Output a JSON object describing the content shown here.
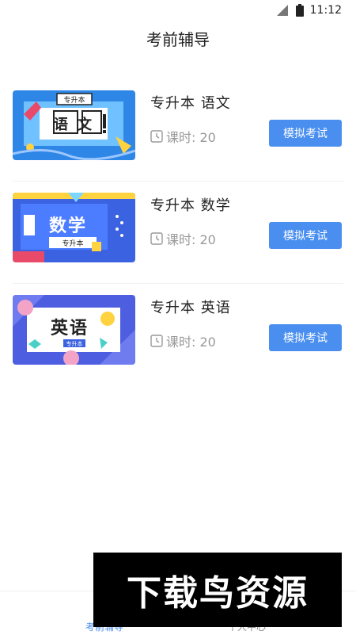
{
  "status_bar": {
    "time": "11:12"
  },
  "header": {
    "title": "考前辅导"
  },
  "courses": [
    {
      "name": "专升本  语文",
      "thumb_text": "语文",
      "thumb_badge": "专升本",
      "hours": "课时: 20",
      "button": "模拟考试"
    },
    {
      "name": "专升本  数学",
      "thumb_text": "数学",
      "thumb_badge": "专升本",
      "hours": "课时: 20",
      "button": "模拟考试"
    },
    {
      "name": "专升本  英语",
      "thumb_text": "英语",
      "thumb_badge": "专升本",
      "hours": "课时: 20",
      "button": "模拟考试"
    }
  ],
  "tab_bar": {
    "tabs": [
      {
        "label": "考前辅导",
        "active": true
      },
      {
        "label": "个人中心",
        "active": false
      }
    ]
  },
  "watermark": {
    "text": "下载鸟资源"
  },
  "colors": {
    "accent": "#4a8ff0",
    "thumb_chinese": "#2e86e6",
    "thumb_math": "#3b62e0",
    "thumb_english": "#4e5ee0"
  }
}
